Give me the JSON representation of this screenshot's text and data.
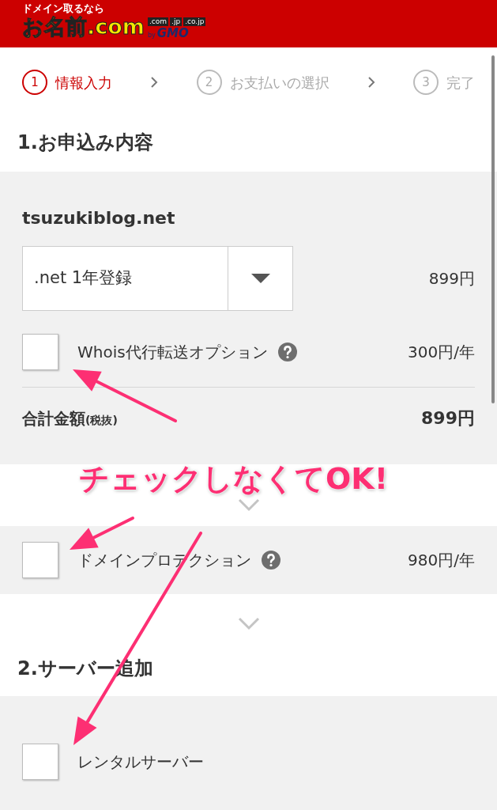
{
  "header": {
    "tagline": "ドメイン取るなら",
    "logo": "お名前.com",
    "tlds": [
      ".com",
      ".jp",
      ".co.jp"
    ],
    "by": "by",
    "company": "GMO"
  },
  "steps": [
    {
      "number": "1",
      "label": "情報入力",
      "selected": true
    },
    {
      "number": "2",
      "label": "お支払いの選択",
      "selected": false
    },
    {
      "number": "3",
      "label": "完了",
      "selected": false
    }
  ],
  "section1": {
    "title": "1.お申込み内容",
    "domain": "tsuzukiblog.net",
    "plan": ".net 1年登録",
    "plan_price": "899円",
    "whois": {
      "label": "Whois代行転送オプション",
      "price": "300円/年",
      "checked": false
    },
    "total_label": "合計金額",
    "total_note": "(税抜)",
    "total": "899円",
    "protection": {
      "label": "ドメインプロテクション",
      "price": "980円/年",
      "checked": false
    }
  },
  "section2": {
    "title": "2.サーバー追加",
    "server": {
      "label": "レンタルサーバー",
      "checked": false
    }
  },
  "annotation": "チェックしなくてOK!"
}
